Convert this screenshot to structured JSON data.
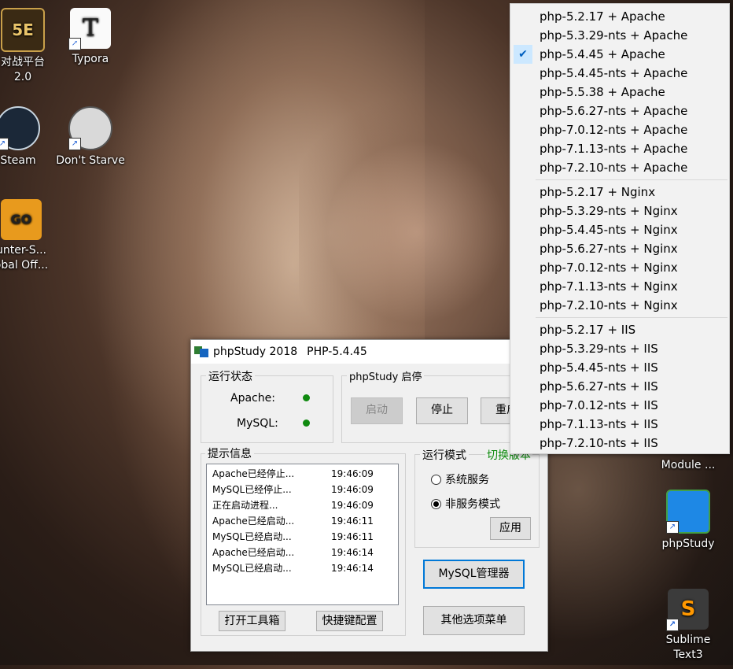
{
  "desktop": {
    "icons": [
      {
        "label": "对战平台\n2.0"
      },
      {
        "label": "Typora"
      },
      {
        "label": "Steam"
      },
      {
        "label": "Don't Starve"
      },
      {
        "label": "unter-S...\nobal Off..."
      },
      {
        "label": "Module ..."
      },
      {
        "label": "phpStudy"
      },
      {
        "label": "Sublime\nText3"
      }
    ]
  },
  "window": {
    "title": "phpStudy 2018",
    "php_version": "PHP-5.4.45",
    "status_group": {
      "legend": "运行状态",
      "apache_label": "Apache:",
      "mysql_label": "MySQL:",
      "status_color": "#108a10"
    },
    "control_group": {
      "legend": "phpStudy  启停",
      "start": "启动",
      "stop": "停止",
      "restart": "重启"
    },
    "info_group": {
      "legend": "提示信息",
      "log": [
        {
          "msg": "Apache已经停止...",
          "time": "19:46:09"
        },
        {
          "msg": "MySQL已经停止...",
          "time": "19:46:09"
        },
        {
          "msg": "正在启动进程...",
          "time": "19:46:09"
        },
        {
          "msg": "Apache已经启动...",
          "time": "19:46:11"
        },
        {
          "msg": "MySQL已经启动...",
          "time": "19:46:11"
        },
        {
          "msg": "Apache已经启动...",
          "time": "19:46:14"
        },
        {
          "msg": "MySQL已经启动...",
          "time": "19:46:14"
        }
      ],
      "toolbox": "打开工具箱",
      "hotkey": "快捷键配置"
    },
    "mode_group": {
      "legend": "运行模式",
      "switch_link": "切换版本",
      "system_service": "系统服务",
      "non_service": "非服务模式",
      "apply": "应用"
    },
    "mysql_manager": "MySQL管理器",
    "other_menu": "其他选项菜单"
  },
  "menu": {
    "checked_index": 2,
    "apache": [
      "php-5.2.17 + Apache",
      "php-5.3.29-nts + Apache",
      "php-5.4.45 + Apache",
      "php-5.4.45-nts + Apache",
      "php-5.5.38 + Apache",
      "php-5.6.27-nts + Apache",
      "php-7.0.12-nts + Apache",
      "php-7.1.13-nts + Apache",
      "php-7.2.10-nts + Apache"
    ],
    "nginx": [
      "php-5.2.17 + Nginx",
      "php-5.3.29-nts + Nginx",
      "php-5.4.45-nts + Nginx",
      "php-5.6.27-nts + Nginx",
      "php-7.0.12-nts + Nginx",
      "php-7.1.13-nts + Nginx",
      "php-7.2.10-nts + Nginx"
    ],
    "iis": [
      "php-5.2.17 + IIS",
      "php-5.3.29-nts + IIS",
      "php-5.4.45-nts + IIS",
      "php-5.6.27-nts + IIS",
      "php-7.0.12-nts + IIS",
      "php-7.1.13-nts + IIS",
      "php-7.2.10-nts + IIS"
    ]
  }
}
